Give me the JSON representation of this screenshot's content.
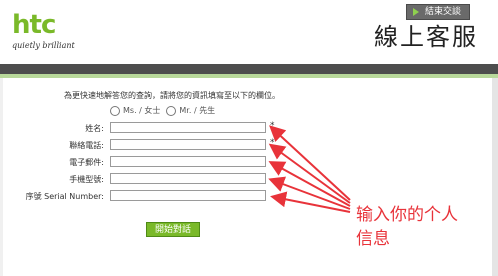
{
  "header": {
    "logo": "htc",
    "tagline": "quietly brilliant",
    "end_chat_label": "結束交談",
    "page_title": "線上客服"
  },
  "form": {
    "instruction": "為更快速地解答您的查詢，請將您的資訊填寫至以下的欄位。",
    "salutation_options": [
      "Ms. / 女士",
      "Mr. / 先生"
    ],
    "fields": [
      {
        "label": "姓名:",
        "value": "",
        "required_mark": "*"
      },
      {
        "label": "聯絡電話:",
        "value": "",
        "required_mark": "*"
      },
      {
        "label": "電子郵件:",
        "value": "",
        "required_mark": ""
      },
      {
        "label": "手機型號:",
        "value": "",
        "required_mark": ""
      },
      {
        "label": "序號 Serial Number:",
        "value": "",
        "required_mark": ""
      }
    ],
    "submit_label": "開始對話"
  },
  "annotation": {
    "line1": "输入你的个人",
    "line2": "信息",
    "color": "#e8333a"
  },
  "colors": {
    "brand_green": "#7ab929",
    "header_bar": "#4d4d4d"
  }
}
